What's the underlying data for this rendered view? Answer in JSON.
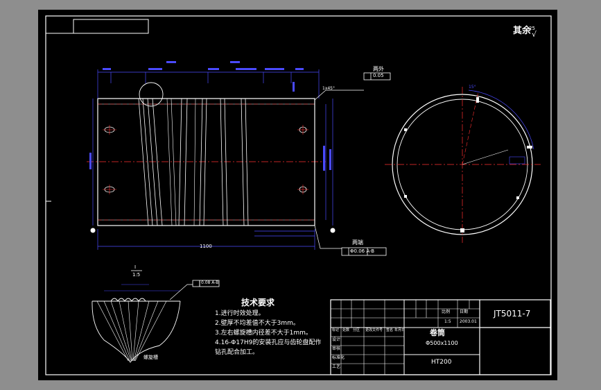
{
  "title_block": {
    "drawing_no": "JT5011-7",
    "part_name": "卷筒",
    "dimension": "Φ500x1100",
    "material": "HT200",
    "scale": "1:5",
    "date": "2003.01",
    "scale_label": "比例",
    "date_label": "日期",
    "rows": [
      "设计",
      "审核",
      "标准化",
      "工艺"
    ],
    "headers": [
      "标记",
      "处数",
      "分区",
      "更改文件号",
      "签名",
      "年月日"
    ]
  },
  "roughness_note": "其余",
  "roughness_value": "25",
  "tech_requirements": {
    "heading": "技术要求",
    "items": [
      "1.进行时效处理。",
      "2.壁厚不均差值不大于3mm。",
      "3.左右螺旋槽内径差不大于1mm。",
      "4.16-Φ17H9的安装孔应与齿轮盘配作",
      "  钻孔配合加工。"
    ]
  },
  "tolerance_frames": {
    "cylindricity": "0.05",
    "runout": "Φ0.06  A-B",
    "parallel": "0.08  A-B"
  },
  "labels": {
    "outer": "两外",
    "inner": "两端",
    "length": "1100",
    "detail_scale_num": "I",
    "detail_scale_den": "1:5",
    "groove": "螺旋槽",
    "angle": "15°",
    "chamfer": "1x45°"
  },
  "colors": {
    "paper": "#000000",
    "line": "#ffffff",
    "center": "#ff3030",
    "dim": "#4a4aff",
    "bg": "#8e8e8e"
  }
}
